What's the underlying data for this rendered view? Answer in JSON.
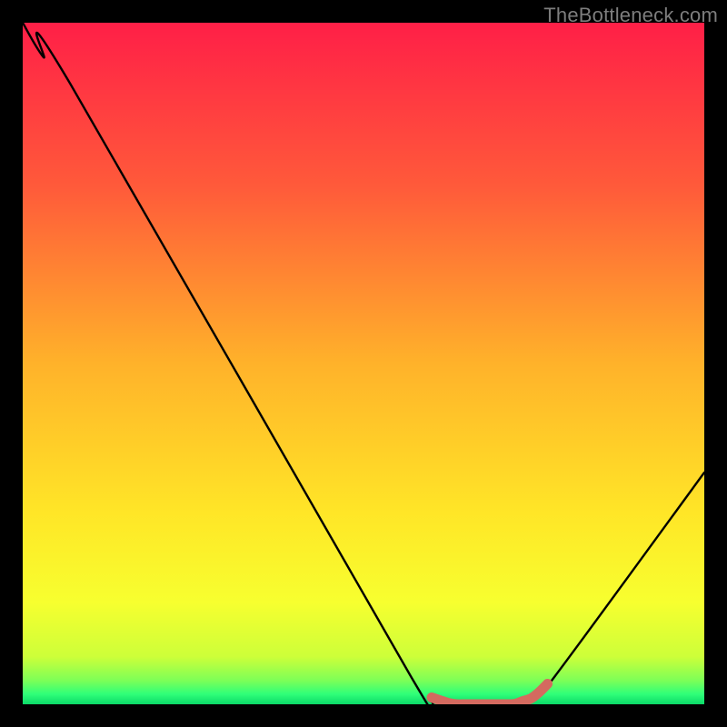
{
  "watermark": "TheBottleneck.com",
  "chart_data": {
    "type": "line",
    "title": "",
    "xlabel": "",
    "ylabel": "",
    "xlim": [
      0,
      100
    ],
    "ylim": [
      0,
      100
    ],
    "x": [
      0,
      3,
      7,
      57,
      60,
      63,
      72,
      75,
      78,
      100
    ],
    "values": [
      100,
      95,
      91,
      4,
      1,
      0,
      0,
      1,
      4,
      34
    ],
    "highlight": {
      "x_start": 60,
      "x_end": 77,
      "color": "#d46a5f"
    },
    "gradient_stops": [
      {
        "offset": 0.0,
        "color": "#ff1f47"
      },
      {
        "offset": 0.24,
        "color": "#ff5a3a"
      },
      {
        "offset": 0.5,
        "color": "#ffb22a"
      },
      {
        "offset": 0.72,
        "color": "#ffe627"
      },
      {
        "offset": 0.85,
        "color": "#f7ff2f"
      },
      {
        "offset": 0.93,
        "color": "#cdff39"
      },
      {
        "offset": 0.965,
        "color": "#7dff57"
      },
      {
        "offset": 0.985,
        "color": "#2fff79"
      },
      {
        "offset": 1.0,
        "color": "#0bd968"
      }
    ]
  }
}
